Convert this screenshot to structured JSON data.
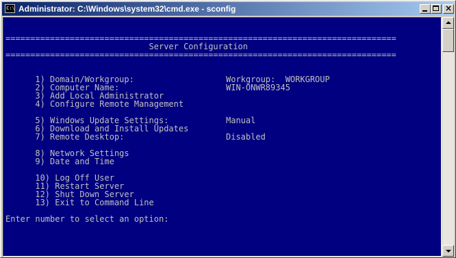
{
  "window": {
    "title": "Administrator: C:\\Windows\\system32\\cmd.exe - sconfig",
    "icon": "cmd-icon",
    "icon_text": "C:\\",
    "close_glyph": "×"
  },
  "console": {
    "rule": "===============================================================================",
    "header": "                             Server Configuration",
    "menu": [
      {
        "label": "1) Domain/Workgroup:",
        "value": "Workgroup:  WORKGROUP"
      },
      {
        "label": "2) Computer Name:",
        "value": "WIN-ONWR89345"
      },
      {
        "label": "3) Add Local Administrator",
        "value": ""
      },
      {
        "label": "4) Configure Remote Management",
        "value": ""
      },
      {
        "label": "5) Windows Update Settings:",
        "value": "Manual"
      },
      {
        "label": "6) Download and Install Updates",
        "value": ""
      },
      {
        "label": "7) Remote Desktop:",
        "value": "Disabled"
      },
      {
        "label": "8) Network Settings",
        "value": ""
      },
      {
        "label": "9) Date and Time",
        "value": ""
      },
      {
        "label": "10) Log Off User",
        "value": ""
      },
      {
        "label": "11) Restart Server",
        "value": ""
      },
      {
        "label": "12) Shut Down Server",
        "value": ""
      },
      {
        "label": "13) Exit to Command Line",
        "value": ""
      }
    ],
    "prompt": "Enter number to select an option:"
  },
  "colors": {
    "console_bg": "#000080",
    "console_fg": "#c0c0c0",
    "titlebar_start": "#0a246a",
    "titlebar_end": "#a6caf0"
  }
}
